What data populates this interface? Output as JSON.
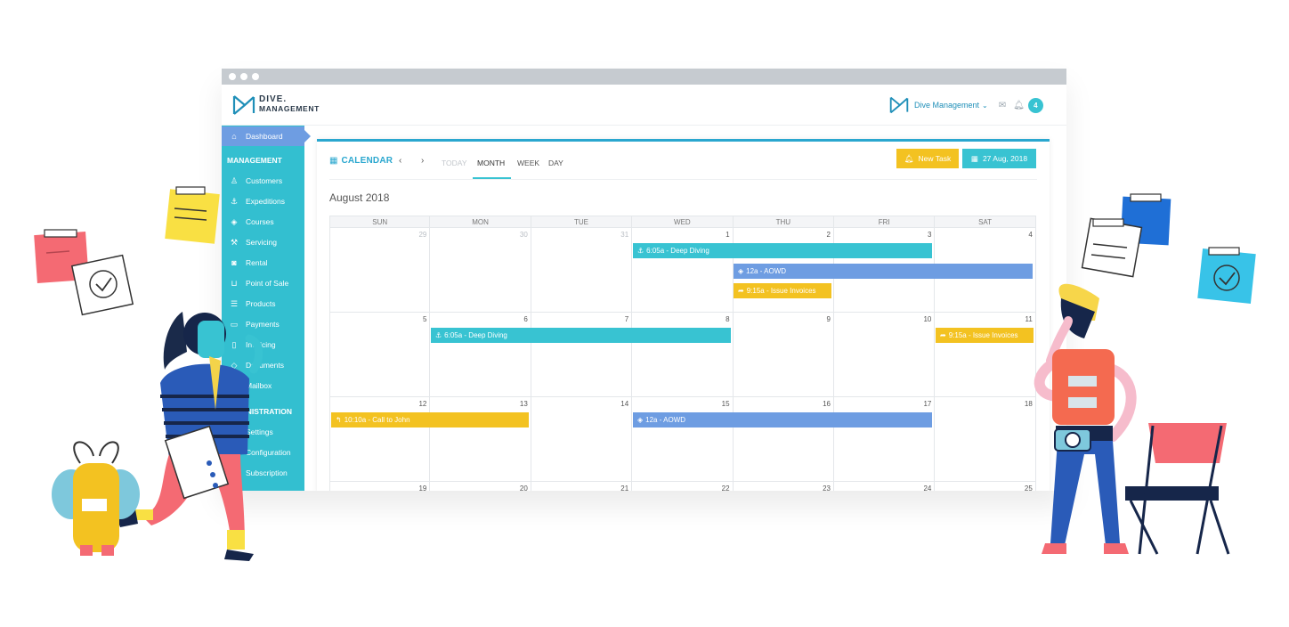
{
  "app": {
    "logo_line1": "DIVE.",
    "logo_line2": "MANAGEMENT",
    "account_name": "Dive Management",
    "notification_count": "4"
  },
  "sidebar": {
    "items": [
      {
        "label": "Dashboard",
        "icon": "home-icon",
        "active": true
      },
      {
        "label": "Customers",
        "icon": "users-icon"
      },
      {
        "label": "Expeditions",
        "icon": "anchor-icon"
      },
      {
        "label": "Courses",
        "icon": "graduation-cap-icon"
      },
      {
        "label": "Servicing",
        "icon": "wrench-icon"
      },
      {
        "label": "Rental",
        "icon": "camera-icon"
      },
      {
        "label": "Point of Sale",
        "icon": "cart-icon"
      },
      {
        "label": "Products",
        "icon": "list-icon"
      },
      {
        "label": "Payments",
        "icon": "credit-card-icon"
      },
      {
        "label": "Invoicing",
        "icon": "file-icon"
      },
      {
        "label": "Documents",
        "icon": "layers-icon"
      },
      {
        "label": "Mailbox",
        "icon": "mail-icon"
      },
      {
        "label": "Settings",
        "icon": "gear-icon"
      },
      {
        "label": "Configuration",
        "icon": "sliders-icon"
      },
      {
        "label": "Subscription",
        "icon": "tag-icon"
      }
    ],
    "section_management": "MANAGEMENT",
    "section_administration": "ADMINISTRATION"
  },
  "calendar": {
    "title": "CALENDAR",
    "prev": "‹",
    "next": "›",
    "view_today": "TODAY",
    "view_month": "MONTH",
    "view_week": "WEEK",
    "view_day": "DAY",
    "new_task": "New Task",
    "date_button": "27 Aug, 2018",
    "month_label": "August 2018",
    "weekdays": [
      "SUN",
      "MON",
      "TUE",
      "WED",
      "THU",
      "FRI",
      "SAT"
    ],
    "weeks": [
      [
        "29",
        "30",
        "31",
        "1",
        "2",
        "3",
        "4"
      ],
      [
        "5",
        "6",
        "7",
        "8",
        "9",
        "10",
        "11"
      ],
      [
        "12",
        "13",
        "14",
        "15",
        "16",
        "17",
        "18"
      ],
      [
        "19",
        "20",
        "21",
        "22",
        "23",
        "24",
        "25"
      ]
    ],
    "events": [
      {
        "label": "6:05a - Deep Diving",
        "color": "#38c3d2",
        "icon": "anchor-icon"
      },
      {
        "label": "12a - AOWD",
        "color": "#6e9de2",
        "icon": "graduation-cap-icon"
      },
      {
        "label": "9:15a - Issue Invoices",
        "color": "#f3c221",
        "icon": "share-icon"
      },
      {
        "label": "6:05a - Deep Diving",
        "color": "#38c3d2",
        "icon": "anchor-icon"
      },
      {
        "label": "9:15a - Issue Invoices",
        "color": "#f3c221",
        "icon": "share-icon"
      },
      {
        "label": "10:10a - Call to John",
        "color": "#f3c221",
        "icon": "reply-icon"
      },
      {
        "label": "12a - AOWD",
        "color": "#6e9de2",
        "icon": "graduation-cap-icon"
      }
    ]
  }
}
